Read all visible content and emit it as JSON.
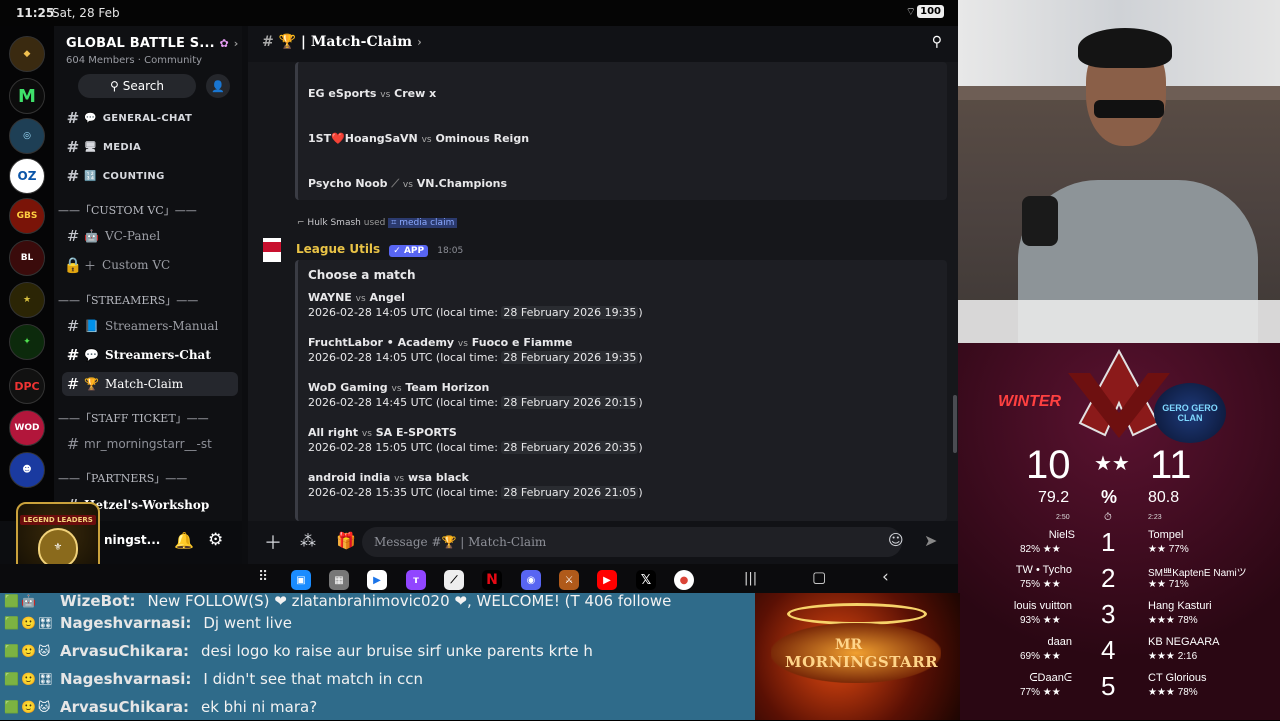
{
  "status": {
    "time": "11:25",
    "date": "Sat, 28 Feb",
    "battery": "100"
  },
  "server": {
    "name": "GLOBAL BATTLE S...",
    "members": "604 Members",
    "type": "Community"
  },
  "search_label": "Search",
  "channels": [
    {
      "label": "GENERAL-CHAT",
      "icon": "speech-icon"
    },
    {
      "label": "MEDIA",
      "icon": "monitor-icon"
    },
    {
      "label": "COUNTING",
      "icon": "grid-icon"
    },
    {
      "label": "VC-Panel",
      "icon": "robot-icon"
    },
    {
      "label": "Custom VC",
      "icon": "lock-icon"
    },
    {
      "label": "Streamers-Manual",
      "icon": "book-icon"
    },
    {
      "label": "Streamers-Chat",
      "icon": "speech-icon"
    },
    {
      "label": "Match-Claim",
      "icon": "trophy-icon"
    },
    {
      "label": "mr_morningstarr__-st",
      "icon": "hash-icon"
    },
    {
      "label": "Hetzel's-Workshop",
      "icon": "hash-icon"
    }
  ],
  "categories": [
    "——「CUSTOM VC」——",
    "——「STREAMERS」——",
    "——「STAFF TICKET」——",
    "——「PARTNERS」——"
  ],
  "user_name": "ningst...",
  "leaders_badge": "LEGEND LEADERS",
  "channel_title": "| Match-Claim",
  "prev_matches": [
    {
      "a": "EG eSports",
      "b": "Crew x"
    },
    {
      "a": "1ST❤️HoangSaVN",
      "b": "Ominous Reign"
    },
    {
      "a": "Psycho Noob",
      "b": "VN.Champions"
    }
  ],
  "vs": "vs",
  "used_line": {
    "user": "Hulk Smash",
    "verb": "used",
    "cmd": "media claim"
  },
  "bot": {
    "name": "League Utils",
    "badge": "APP",
    "time": "18:05"
  },
  "embed_title": "Choose a match",
  "matches": [
    {
      "a": "WAYNE",
      "b": "Angel",
      "utc": "2026-02-28 14:05 UTC (local time: ",
      "local": "28 February 2026 19:35",
      "close": ")"
    },
    {
      "a": "FruchtLabor • Academy",
      "b": "Fuoco e Fiamme",
      "utc": "2026-02-28 14:05 UTC (local time: ",
      "local": "28 February 2026 19:35",
      "close": ")"
    },
    {
      "a": "WoD Gaming",
      "b": "Team Horizon",
      "utc": "2026-02-28 14:45 UTC (local time: ",
      "local": "28 February 2026 20:15",
      "close": ")"
    },
    {
      "a": "All right",
      "b": "SA E-SPORTS",
      "utc": "2026-02-28 15:05 UTC (local time: ",
      "local": "28 February 2026 20:35",
      "close": ")"
    },
    {
      "a": "android india",
      "b": "wsa black",
      "utc": "2026-02-28 15:35 UTC (local time: ",
      "local": "28 February 2026 21:05",
      "close": ")"
    }
  ],
  "message_placeholder": "Message #🏆 | Match-Claim",
  "scoreboard": {
    "team_left": "WINTER",
    "team_right": "GERO GERO CLAN",
    "score_left": "10",
    "score_right": "11",
    "rate_left": "79.2",
    "rate_right": "80.8",
    "pct": "%",
    "time_left": "2:50",
    "time_right": "2:23",
    "rows": [
      {
        "rank": "1",
        "left": "NielS",
        "lp": "82%",
        "right": "Tompel",
        "rp": "77%"
      },
      {
        "rank": "2",
        "left": "TW • Tycho",
        "lp": "75%",
        "right": "SM쁘KaptenE Namiツ",
        "rp": "71%"
      },
      {
        "rank": "3",
        "left": "louis vuitton",
        "lp": "93%",
        "right": "Hang Kasturi",
        "rp": "78%"
      },
      {
        "rank": "4",
        "left": "daan",
        "lp": "69%",
        "right": "KB NEGAARA",
        "rp": "2:16"
      },
      {
        "rank": "5",
        "left": "ᕮDaanᕮ",
        "lp": "77%",
        "right": "CT Glorious",
        "rp": "78%"
      }
    ]
  },
  "chat": [
    {
      "user": "WizeBot:",
      "msg": "New FOLLOW(S) ❤ zlatanbrahimovic020 ❤, WELCOME! (T 406 followe"
    },
    {
      "user": "Nageshvarnasi:",
      "msg": "Dj went live"
    },
    {
      "user": "ArvasuChikara:",
      "msg": "desi logo ko raise aur bruise sirf unke parents krte h"
    },
    {
      "user": "Nageshvarnasi:",
      "msg": "I didn't see that match in ccn"
    },
    {
      "user": "ArvasuChikara:",
      "msg": "ek bhi ni mara?"
    }
  ],
  "stream_logo": {
    "line1": "MR",
    "line2": "MORNINGSTARR"
  }
}
